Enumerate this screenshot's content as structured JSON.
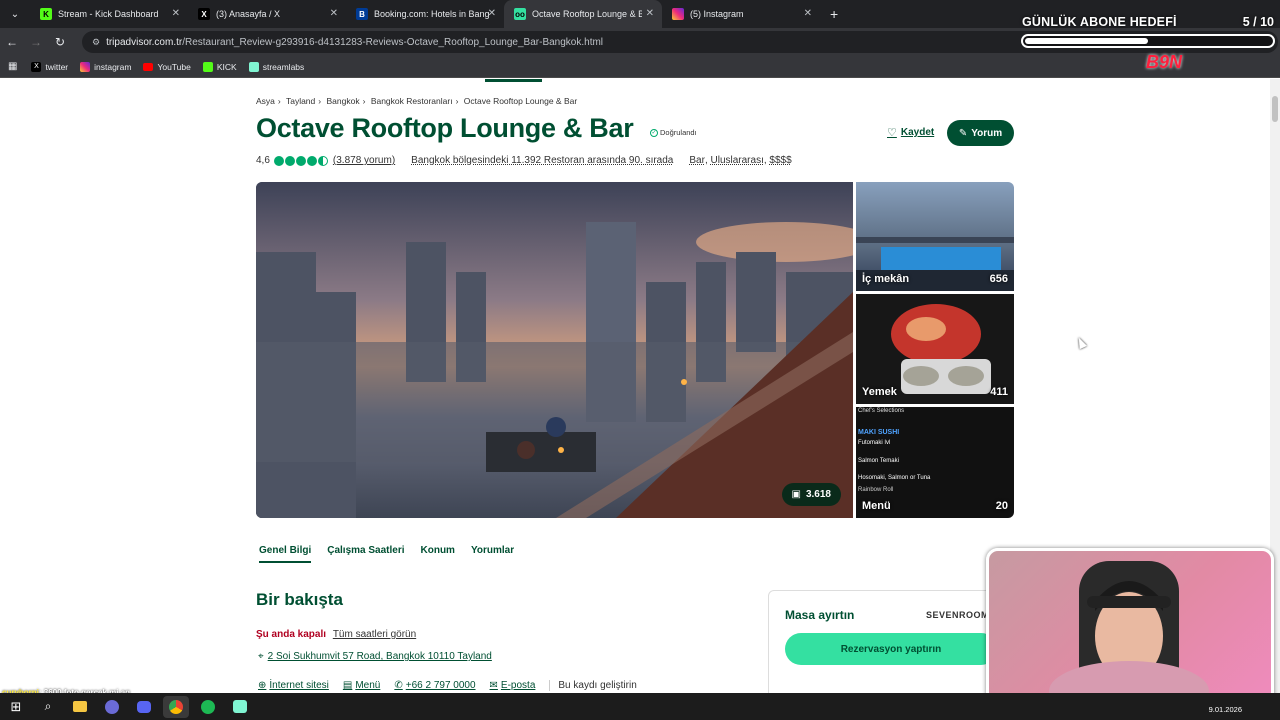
{
  "browser": {
    "tabs": [
      {
        "label": "Stream - Kick Dashboard",
        "icon": "kick-icon",
        "color": "#53fc18"
      },
      {
        "label": "(3) Anasayfa / X",
        "icon": "x-icon",
        "color": "#ffffff"
      },
      {
        "label": "Booking.com: Hotels in Bangkok",
        "icon": "booking-icon",
        "color": "#003b95"
      },
      {
        "label": "Octave Rooftop Lounge & Bar",
        "icon": "tripadvisor-icon",
        "color": "#34e0a1",
        "active": true
      },
      {
        "label": "(5) Instagram",
        "icon": "instagram-icon",
        "color": "#e1306c"
      }
    ],
    "url_domain": "tripadvisor.com.tr",
    "url_path": "/Restaurant_Review-g293916-d4131283-Reviews-Octave_Rooftop_Lounge_Bar-Bangkok.html",
    "bookmarks": [
      {
        "label": "twitter",
        "icon": "x-icon"
      },
      {
        "label": "instagram",
        "icon": "instagram-icon"
      },
      {
        "label": "YouTube",
        "icon": "youtube-icon"
      },
      {
        "label": "KICK",
        "icon": "kick-icon"
      },
      {
        "label": "streamlabs",
        "icon": "streamlabs-icon"
      }
    ]
  },
  "overlay": {
    "goal_title": "GÜNLÜK ABONE HEDEFİ",
    "goal_count": "5 / 10",
    "goal_progress": 0.5,
    "chat_user": "curyborni",
    "chat_message": ": 3600 foto gerçek mi aq"
  },
  "page": {
    "breadcrumbs": [
      "Asya",
      "Tayland",
      "Bangkok",
      "Bangkok Restoranları",
      "Octave Rooftop Lounge & Bar"
    ],
    "title": "Octave Rooftop Lounge & Bar",
    "verified": "Doğrulandı",
    "save_label": "Kaydet",
    "review_label": "Yorum",
    "rating": "4,6",
    "rating_value": 4.5,
    "review_count": "(3.878 yorum)",
    "ranking": "Bangkok bölgesindeki 11.392 Restoran arasında 90. sırada",
    "cuisine": [
      "Bar",
      "Uluslararası",
      "$$$$"
    ],
    "photos_total": "3.618",
    "thumbs": [
      {
        "label": "İç mekân",
        "count": "656"
      },
      {
        "label": "Yemek",
        "count": "411"
      },
      {
        "label": "Menü",
        "count": "20"
      }
    ],
    "subnav": [
      "Genel Bilgi",
      "Çalışma Saatleri",
      "Konum",
      "Yorumlar"
    ],
    "overview_heading": "Bir bakışta",
    "status": "Şu anda kapalı",
    "hours_link": "Tüm saatleri görün",
    "address": "2 Soi Sukhumvit 57 Road, Bangkok 10110 Tayland",
    "website": "İnternet sitesi",
    "menu": "Menü",
    "phone": "+66 2 797 0000",
    "email": "E-posta",
    "improve": "Bu kaydı geliştirin",
    "booking_title": "Masa ayırtın",
    "booking_provider": "SEVENROOMS",
    "booking_button": "Rezervasyon yaptırın",
    "menu_card": {
      "header": "Chef's Selections",
      "section": "MAKI SUSHI",
      "items": [
        "Futomaki Ivl",
        "Salmon Temaki",
        "Hosomaki, Salmon or Tuna",
        "Rainbow Roll"
      ]
    }
  },
  "taskbar": {
    "date": "9.01.2026"
  }
}
